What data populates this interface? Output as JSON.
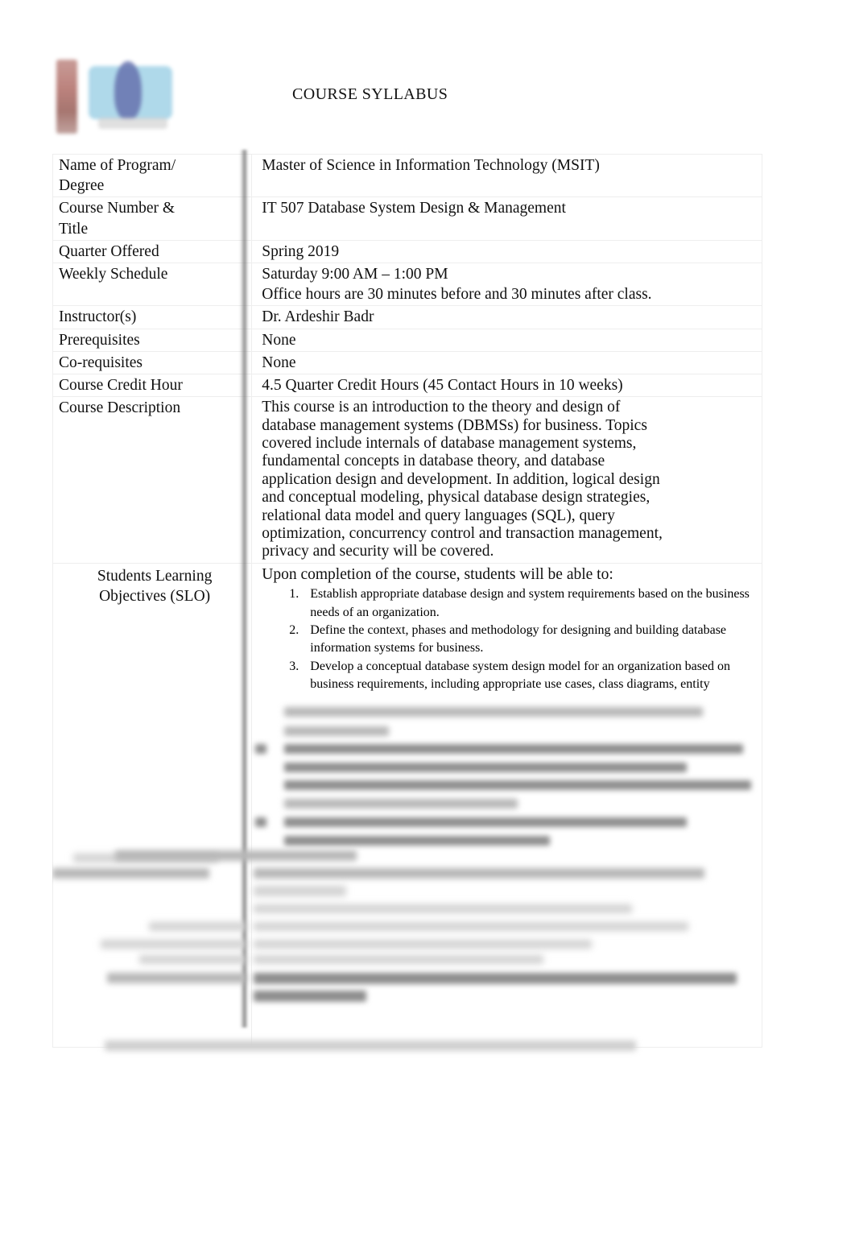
{
  "document": {
    "title": "COURSE SYLLABUS",
    "logo_icon": "institution-logo"
  },
  "table": {
    "rows": [
      {
        "label": "Name of Program/ Degree",
        "label_line1": "Name of Program/",
        "label_line2": "Degree",
        "value": "Master of Science in Information Technology (MSIT)"
      },
      {
        "label": "Course Number & Title",
        "label_line1": "Course Number &",
        "label_line2": "Title",
        "value": "IT 507 Database System Design & Management"
      },
      {
        "label": "Quarter Offered",
        "value": "Spring 2019"
      },
      {
        "label": "Weekly Schedule",
        "value": "Saturday 9:00 AM – 1:00 PM",
        "value_line2": "Office hours are 30 minutes before and 30 minutes after class."
      },
      {
        "label": "Instructor(s)",
        "value": "Dr. Ardeshir Badr"
      },
      {
        "label": "Prerequisites",
        "value": "None"
      },
      {
        "label": "Co-requisites",
        "value": "None"
      },
      {
        "label": "Course Credit Hour",
        "value": "4.5 Quarter Credit Hours (45 Contact Hours in 10 weeks)"
      },
      {
        "label": "Course Description",
        "value": "This course is an introduction to the theory and design of database management systems (DBMSs) for business. Topics covered include internals of database management systems, fundamental concepts in database theory, and database application design and development. In addition, logical design and conceptual modeling, physical database design strategies, relational data model and query languages (SQL), query optimization, concurrency control and transaction management, privacy and security will be covered."
      }
    ],
    "slo": {
      "label_line1": "Students Learning",
      "label_line2": "Objectives (SLO)",
      "intro": "Upon completion of the course, students will be able to:",
      "items": [
        "Establish appropriate database design and system requirements based on the business needs of an organization.",
        "Define the context, phases and methodology for designing and building database information systems for business.",
        "Develop a conceptual database system design model for an organization based on business requirements, including appropriate use cases, class diagrams, entity"
      ]
    }
  },
  "colors": {
    "text": "#101010",
    "border": "#eeeeee",
    "divider": "#6f6f6f"
  }
}
